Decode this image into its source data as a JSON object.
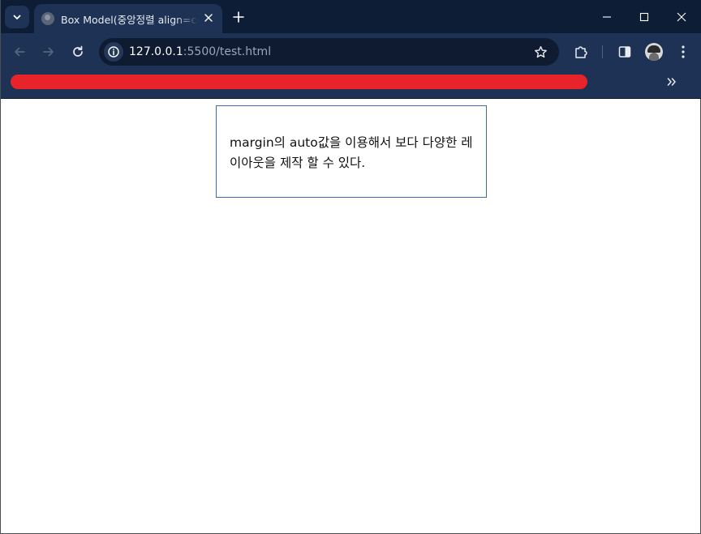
{
  "tab": {
    "title": "Box Model(중앙정렬 align=center)"
  },
  "address_bar": {
    "url_host": "127.0.0.1",
    "url_rest": ":5500/test.html"
  },
  "icons": {
    "tab_search": "chevron-down-icon",
    "favicon": "globe-icon",
    "tab_close": "close-icon",
    "new_tab": "plus-icon",
    "minimize": "minimize-icon",
    "maximize": "maximize-icon",
    "close_window": "close-icon",
    "back": "back-arrow-icon",
    "forward": "forward-arrow-icon",
    "reload": "reload-icon",
    "site_info": "info-icon",
    "bookmark_star": "star-icon",
    "extensions": "puzzle-icon",
    "side_panel": "side-panel-icon",
    "profile": "avatar",
    "menu": "kebab-menu-icon",
    "bookmarks_overflow": "double-chevron-right-icon"
  },
  "colors": {
    "tabstrip": "#0e1d36",
    "toolbar": "#1d3254",
    "redacted_bookmarks": "#e8242a",
    "box_border": "#3a6ea5"
  },
  "page": {
    "box_text": "margin의 auto값을 이용해서 보다 다양한 레이아웃을 제작 할 수 있다."
  }
}
